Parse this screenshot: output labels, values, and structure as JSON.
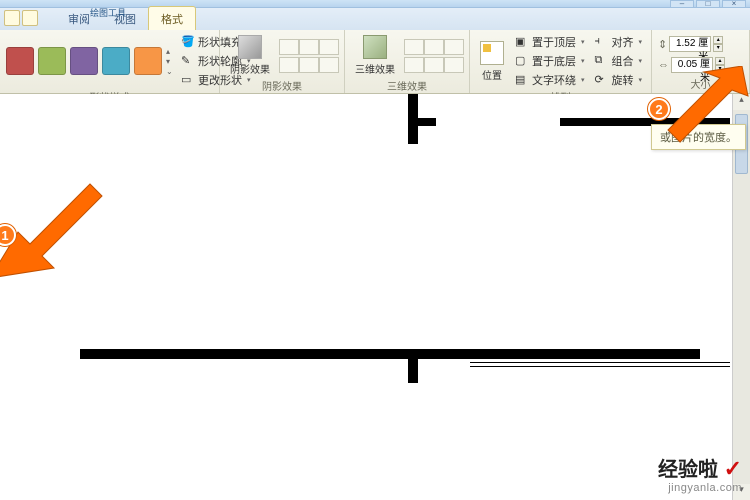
{
  "window": {
    "tool_title": "绘图工具"
  },
  "tabs": {
    "review": "审阅",
    "view": "视图",
    "format": "格式"
  },
  "ribbon": {
    "styles": {
      "label": "形状样式",
      "colors": [
        "#c0504d",
        "#9bbb59",
        "#8064a2",
        "#4bacc6",
        "#f79646"
      ],
      "fill": "形状填充",
      "outline": "形状轮廓",
      "change": "更改形状"
    },
    "shadow": {
      "label": "阴影效果",
      "btn": "阴影效果"
    },
    "threeD": {
      "label": "三维效果",
      "btn": "三维效果"
    },
    "arrange": {
      "label": "排列",
      "position": "位置",
      "front": "置于顶层",
      "back": "置于底层",
      "wrap": "文字环绕",
      "align": "对齐",
      "group": "组合",
      "rotate": "旋转"
    },
    "size": {
      "label": "大小",
      "height": "1.52",
      "height_unit": "厘米",
      "width": "0.05",
      "width_unit": "厘米"
    }
  },
  "tooltip": {
    "text": "或图片的宽度。"
  },
  "callouts": {
    "one": "1",
    "two": "2"
  },
  "watermark": {
    "brand": "经验啦",
    "url": "jingyanla.com"
  }
}
